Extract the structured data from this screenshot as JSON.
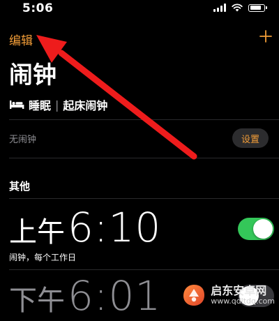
{
  "status_bar": {
    "time": "5:06",
    "battery_level": 0.85,
    "icons": [
      "signal-icon",
      "wifi-icon",
      "battery-icon"
    ]
  },
  "nav": {
    "edit_label": "编辑",
    "add_icon": "plus-icon",
    "title": "闹钟"
  },
  "sleep": {
    "icon": "bed-icon",
    "label": "睡眠",
    "separator": "|",
    "sublabel": "起床闹钟",
    "no_alarm_text": "无闹钟",
    "settings_label": "设置"
  },
  "other": {
    "header": "其他",
    "alarms": [
      {
        "ampm": "上午",
        "time": "6:10",
        "subtitle": "闹钟，每个工作日",
        "enabled": true
      },
      {
        "ampm": "下午",
        "time": "6:01",
        "subtitle": "",
        "enabled": false
      }
    ]
  },
  "annotation": {
    "icon": "red-arrow-icon",
    "color": "#ee1c1c"
  },
  "colors": {
    "accent": "#f29d38",
    "toggle_on": "#34c759",
    "background": "#000000"
  },
  "watermark": {
    "name": "启东安卓网",
    "url": "www.qdltdq.com"
  }
}
